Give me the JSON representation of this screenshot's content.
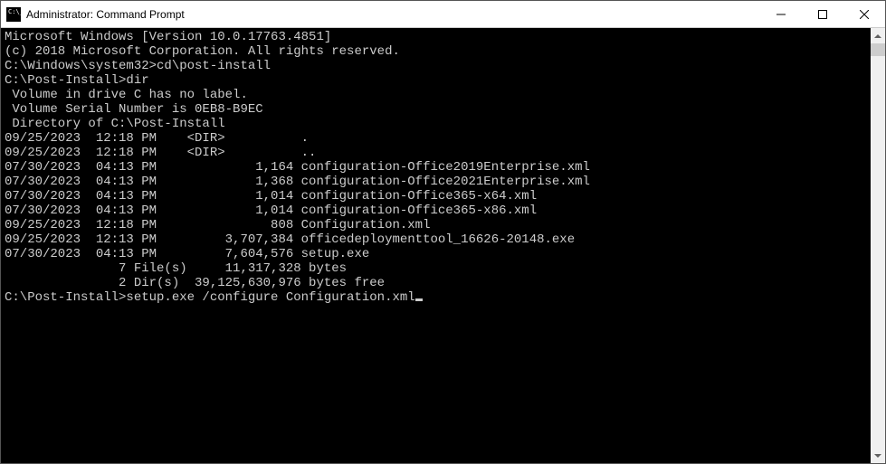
{
  "window": {
    "title": "Administrator: Command Prompt"
  },
  "terminal": {
    "lines": [
      "Microsoft Windows [Version 10.0.17763.4851]",
      "(c) 2018 Microsoft Corporation. All rights reserved.",
      "",
      "C:\\Windows\\system32>cd\\post-install",
      "",
      "C:\\Post-Install>dir",
      " Volume in drive C has no label.",
      " Volume Serial Number is 0EB8-B9EC",
      "",
      " Directory of C:\\Post-Install",
      "",
      "09/25/2023  12:18 PM    <DIR>          .",
      "09/25/2023  12:18 PM    <DIR>          ..",
      "07/30/2023  04:13 PM             1,164 configuration-Office2019Enterprise.xml",
      "07/30/2023  04:13 PM             1,368 configuration-Office2021Enterprise.xml",
      "07/30/2023  04:13 PM             1,014 configuration-Office365-x64.xml",
      "07/30/2023  04:13 PM             1,014 configuration-Office365-x86.xml",
      "09/25/2023  12:18 PM               808 Configuration.xml",
      "09/25/2023  12:13 PM         3,707,384 officedeploymenttool_16626-20148.exe",
      "07/30/2023  04:13 PM         7,604,576 setup.exe",
      "               7 File(s)     11,317,328 bytes",
      "               2 Dir(s)  39,125,630,976 bytes free",
      "",
      "C:\\Post-Install>setup.exe /configure Configuration.xml"
    ]
  }
}
